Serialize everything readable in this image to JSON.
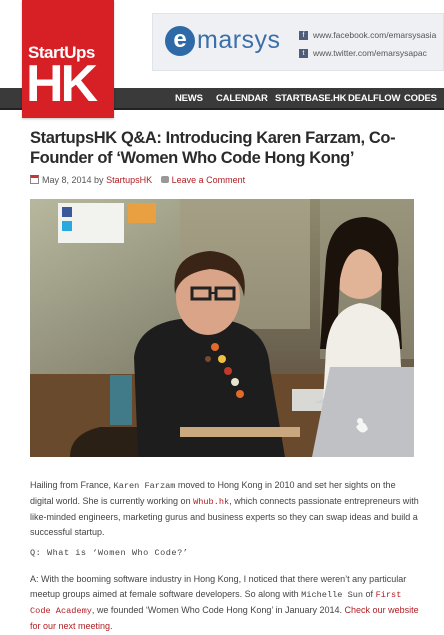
{
  "logo": {
    "line1": "StartUps",
    "line2": "HK"
  },
  "banner": {
    "brand_first": "e",
    "brand_rest": "marsys",
    "facebook_icon_letter": "f",
    "twitter_icon_letter": "t",
    "facebook_url": "www.facebook.com/emarsysasia",
    "twitter_url": "www.twitter.com/emarsysapac"
  },
  "nav": {
    "items": [
      "NEWS",
      "CALENDAR",
      "STARTBASE.HK",
      "DEALFLOW",
      "CODES"
    ]
  },
  "article": {
    "title": "StartupsHK Q&A: Introducing Karen Farzam, Co-Founder of ‘Women Who Code Hong Kong’",
    "date": "May 8, 2014",
    "by": "by",
    "author": "StartupsHK",
    "comment_link": "Leave a Comment",
    "p1": {
      "t1": "Hailing from France, ",
      "name": "Karen Farzam",
      "t2": " moved to Hong Kong in 2010 and set her sights on the digital world. She is currently working on ",
      "link": "Whub.hk",
      "t3": ", which connects passionate entrepreneurs with like-minded engineers, marketing gurus and business experts so they can swap ideas and build a successful startup."
    },
    "question": "Q: What is ‘Women Who Code?’",
    "p2": {
      "t1": "A: With the booming software industry in Hong Kong, I noticed that there weren’t any particular meetup groups aimed at female software developers. So along with ",
      "name": "Michelle Sun",
      "t2": " of ",
      "link1": "First Code Academy",
      "t3": ", we founded ‘Women Who Code Hong Kong’ in January 2014. ",
      "link2": "Check our website for our next meeting",
      "t4": "."
    }
  },
  "colors": {
    "brand_red": "#d71f26",
    "nav_bg": "#3a3a3a",
    "link": "#b11d22"
  }
}
